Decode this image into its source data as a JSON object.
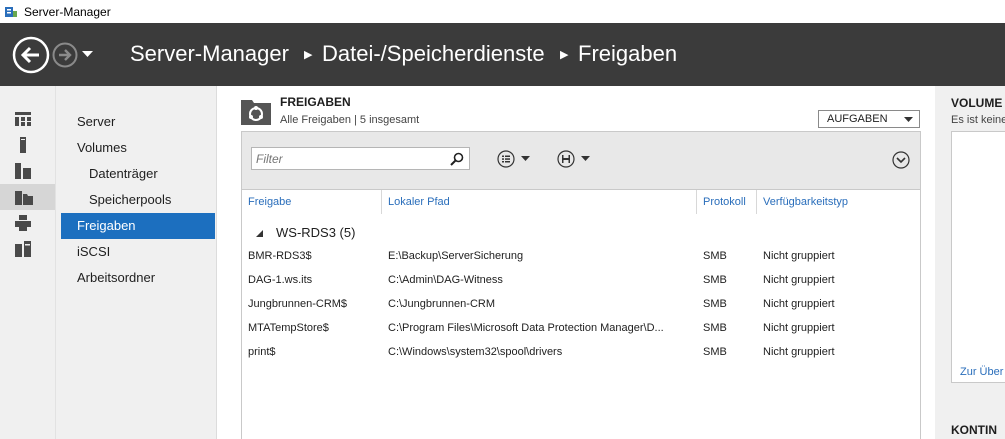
{
  "window": {
    "title": "Server-Manager"
  },
  "breadcrumb": {
    "root": "Server-Manager",
    "level1": "Datei-/Speicherdienste",
    "level2": "Freigaben"
  },
  "sidenav": {
    "items": [
      {
        "label": "Server"
      },
      {
        "label": "Volumes"
      },
      {
        "label": "Datenträger"
      },
      {
        "label": "Speicherpools"
      },
      {
        "label": "Freigaben"
      },
      {
        "label": "iSCSI"
      },
      {
        "label": "Arbeitsordner"
      }
    ],
    "active": "Freigaben"
  },
  "section": {
    "title": "FREIGABEN",
    "subtitle": "Alle Freigaben | 5 insgesamt",
    "tasks_label": "AUFGABEN",
    "filter_placeholder": "Filter"
  },
  "table": {
    "columns": [
      "Freigabe",
      "Lokaler Pfad",
      "Protokoll",
      "Verfügbarkeitstyp"
    ],
    "group_label": "WS-RDS3 (5)",
    "rows": [
      [
        "BMR-RDS3$",
        "E:\\Backup\\ServerSicherung",
        "SMB",
        "Nicht gruppiert"
      ],
      [
        "DAG-1.ws.its",
        "C:\\Admin\\DAG-Witness",
        "SMB",
        "Nicht gruppiert"
      ],
      [
        "Jungbrunnen-CRM$",
        "C:\\Jungbrunnen-CRM",
        "SMB",
        "Nicht gruppiert"
      ],
      [
        "MTATempStore$",
        "C:\\Program Files\\Microsoft Data Protection Manager\\D...",
        "SMB",
        "Nicht gruppiert"
      ],
      [
        "print$",
        "C:\\Windows\\system32\\spool\\drivers",
        "SMB",
        "Nicht gruppiert"
      ]
    ]
  },
  "right_pane": {
    "title": "VOLUME",
    "subtitle": "Es ist keine",
    "link": "Zur Über",
    "title2": "KONTIN"
  },
  "colors": {
    "header_bg": "#3b3b3b",
    "accent": "#1c6fbf",
    "link": "#2a6ebb"
  },
  "icons": [
    "back-arrow-icon",
    "forward-arrow-icon",
    "dashboard-icon",
    "local-server-icon",
    "all-servers-icon",
    "file-storage-icon",
    "print-icon",
    "remote-desktop-icon",
    "search-icon",
    "list-view-icon",
    "save-query-icon",
    "expand-icon"
  ]
}
